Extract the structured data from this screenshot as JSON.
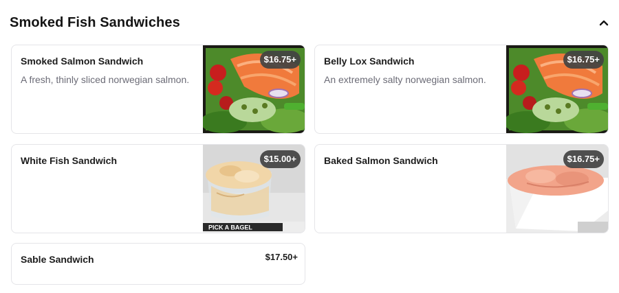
{
  "section": {
    "title": "Smoked Fish Sandwiches"
  },
  "items": [
    {
      "name": "Smoked Salmon Sandwich",
      "description": "A fresh, thinly sliced norwegian salmon.",
      "price": "$16.75+"
    },
    {
      "name": "Belly Lox Sandwich",
      "description": "An extremely salty norwegian salmon.",
      "price": "$16.75+"
    },
    {
      "name": "White Fish Sandwich",
      "description": "",
      "price": "$15.00+"
    },
    {
      "name": "Baked Salmon Sandwich",
      "description": "",
      "price": "$16.75+"
    },
    {
      "name": "Sable Sandwich",
      "description": "",
      "price": "$17.50+"
    }
  ],
  "image_labels": {
    "pick_a_bagel": "PICK A BAGEL"
  },
  "colors": {
    "badge": "#424242",
    "text": "#1c1c1c",
    "muted": "#6b6b76",
    "border": "#e4e4e8"
  },
  "icons": {
    "collapse": "chevron-up-icon"
  }
}
